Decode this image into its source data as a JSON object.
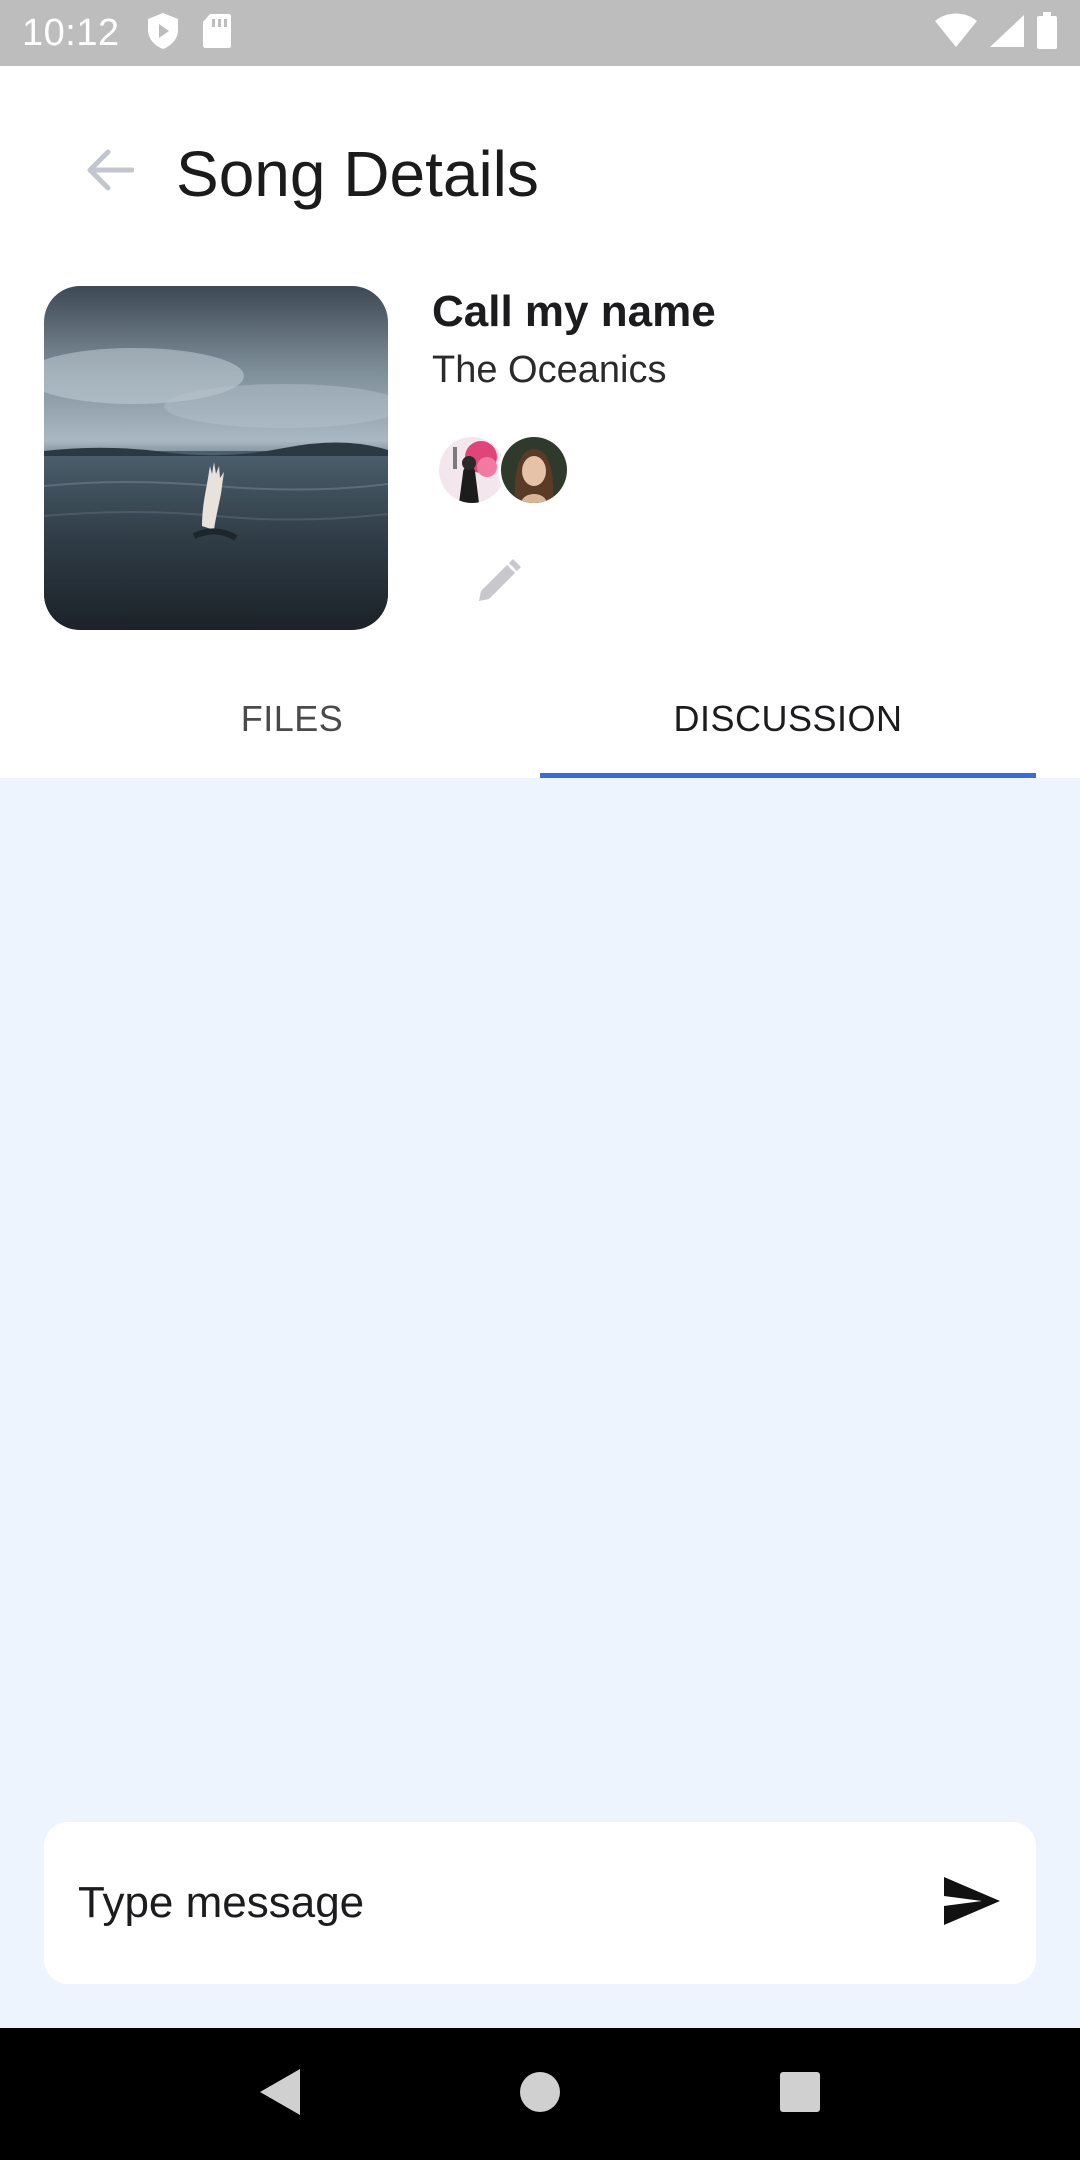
{
  "status_bar": {
    "time": "10:12",
    "icons_left": [
      "shield-icon",
      "sd-card-icon"
    ],
    "icons_right": [
      "wifi-icon",
      "cell-signal-icon",
      "battery-icon"
    ]
  },
  "header": {
    "title": "Song Details",
    "back_icon": "arrow-left-icon"
  },
  "song": {
    "title": "Call my name",
    "artist": "The Oceanics",
    "cover_description": "hand-in-ocean-image",
    "collaborators": [
      "collaborator-1",
      "collaborator-2"
    ]
  },
  "tabs": [
    {
      "label": "FILES",
      "active": false
    },
    {
      "label": "DISCUSSION",
      "active": true
    }
  ],
  "composer": {
    "placeholder": "Type message",
    "send_icon": "send-icon"
  },
  "colors": {
    "accent": "#3b6ad9",
    "discussion_bg": "#eef4fd",
    "status_bar": "#bdbdbd"
  }
}
